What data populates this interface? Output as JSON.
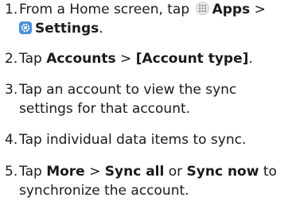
{
  "steps": [
    {
      "num": "1.",
      "line1_pre": "From a Home screen, tap",
      "line1_bold": "Apps",
      "line1_sep": ">",
      "line2_bold": "Settings",
      "line2_post": "."
    },
    {
      "num": "2.",
      "pre": "Tap",
      "bold1": "Accounts",
      "sep": ">",
      "bold2": "[Account type]",
      "post": "."
    },
    {
      "num": "3.",
      "line1": "Tap an account to view the sync",
      "line2": "settings for that account."
    },
    {
      "num": "4.",
      "line1": "Tap individual data items to sync."
    },
    {
      "num": "5.",
      "pre": "Tap",
      "bold1": "More",
      "sep": ">",
      "bold2": "Sync all",
      "mid": "or",
      "bold3": "Sync now",
      "post_cut": "to",
      "line2": "synchronize the account."
    }
  ],
  "icons": {
    "apps": "apps-grid-icon",
    "settings": "settings-gear-icon",
    "settings_color": "#4a90d9"
  }
}
